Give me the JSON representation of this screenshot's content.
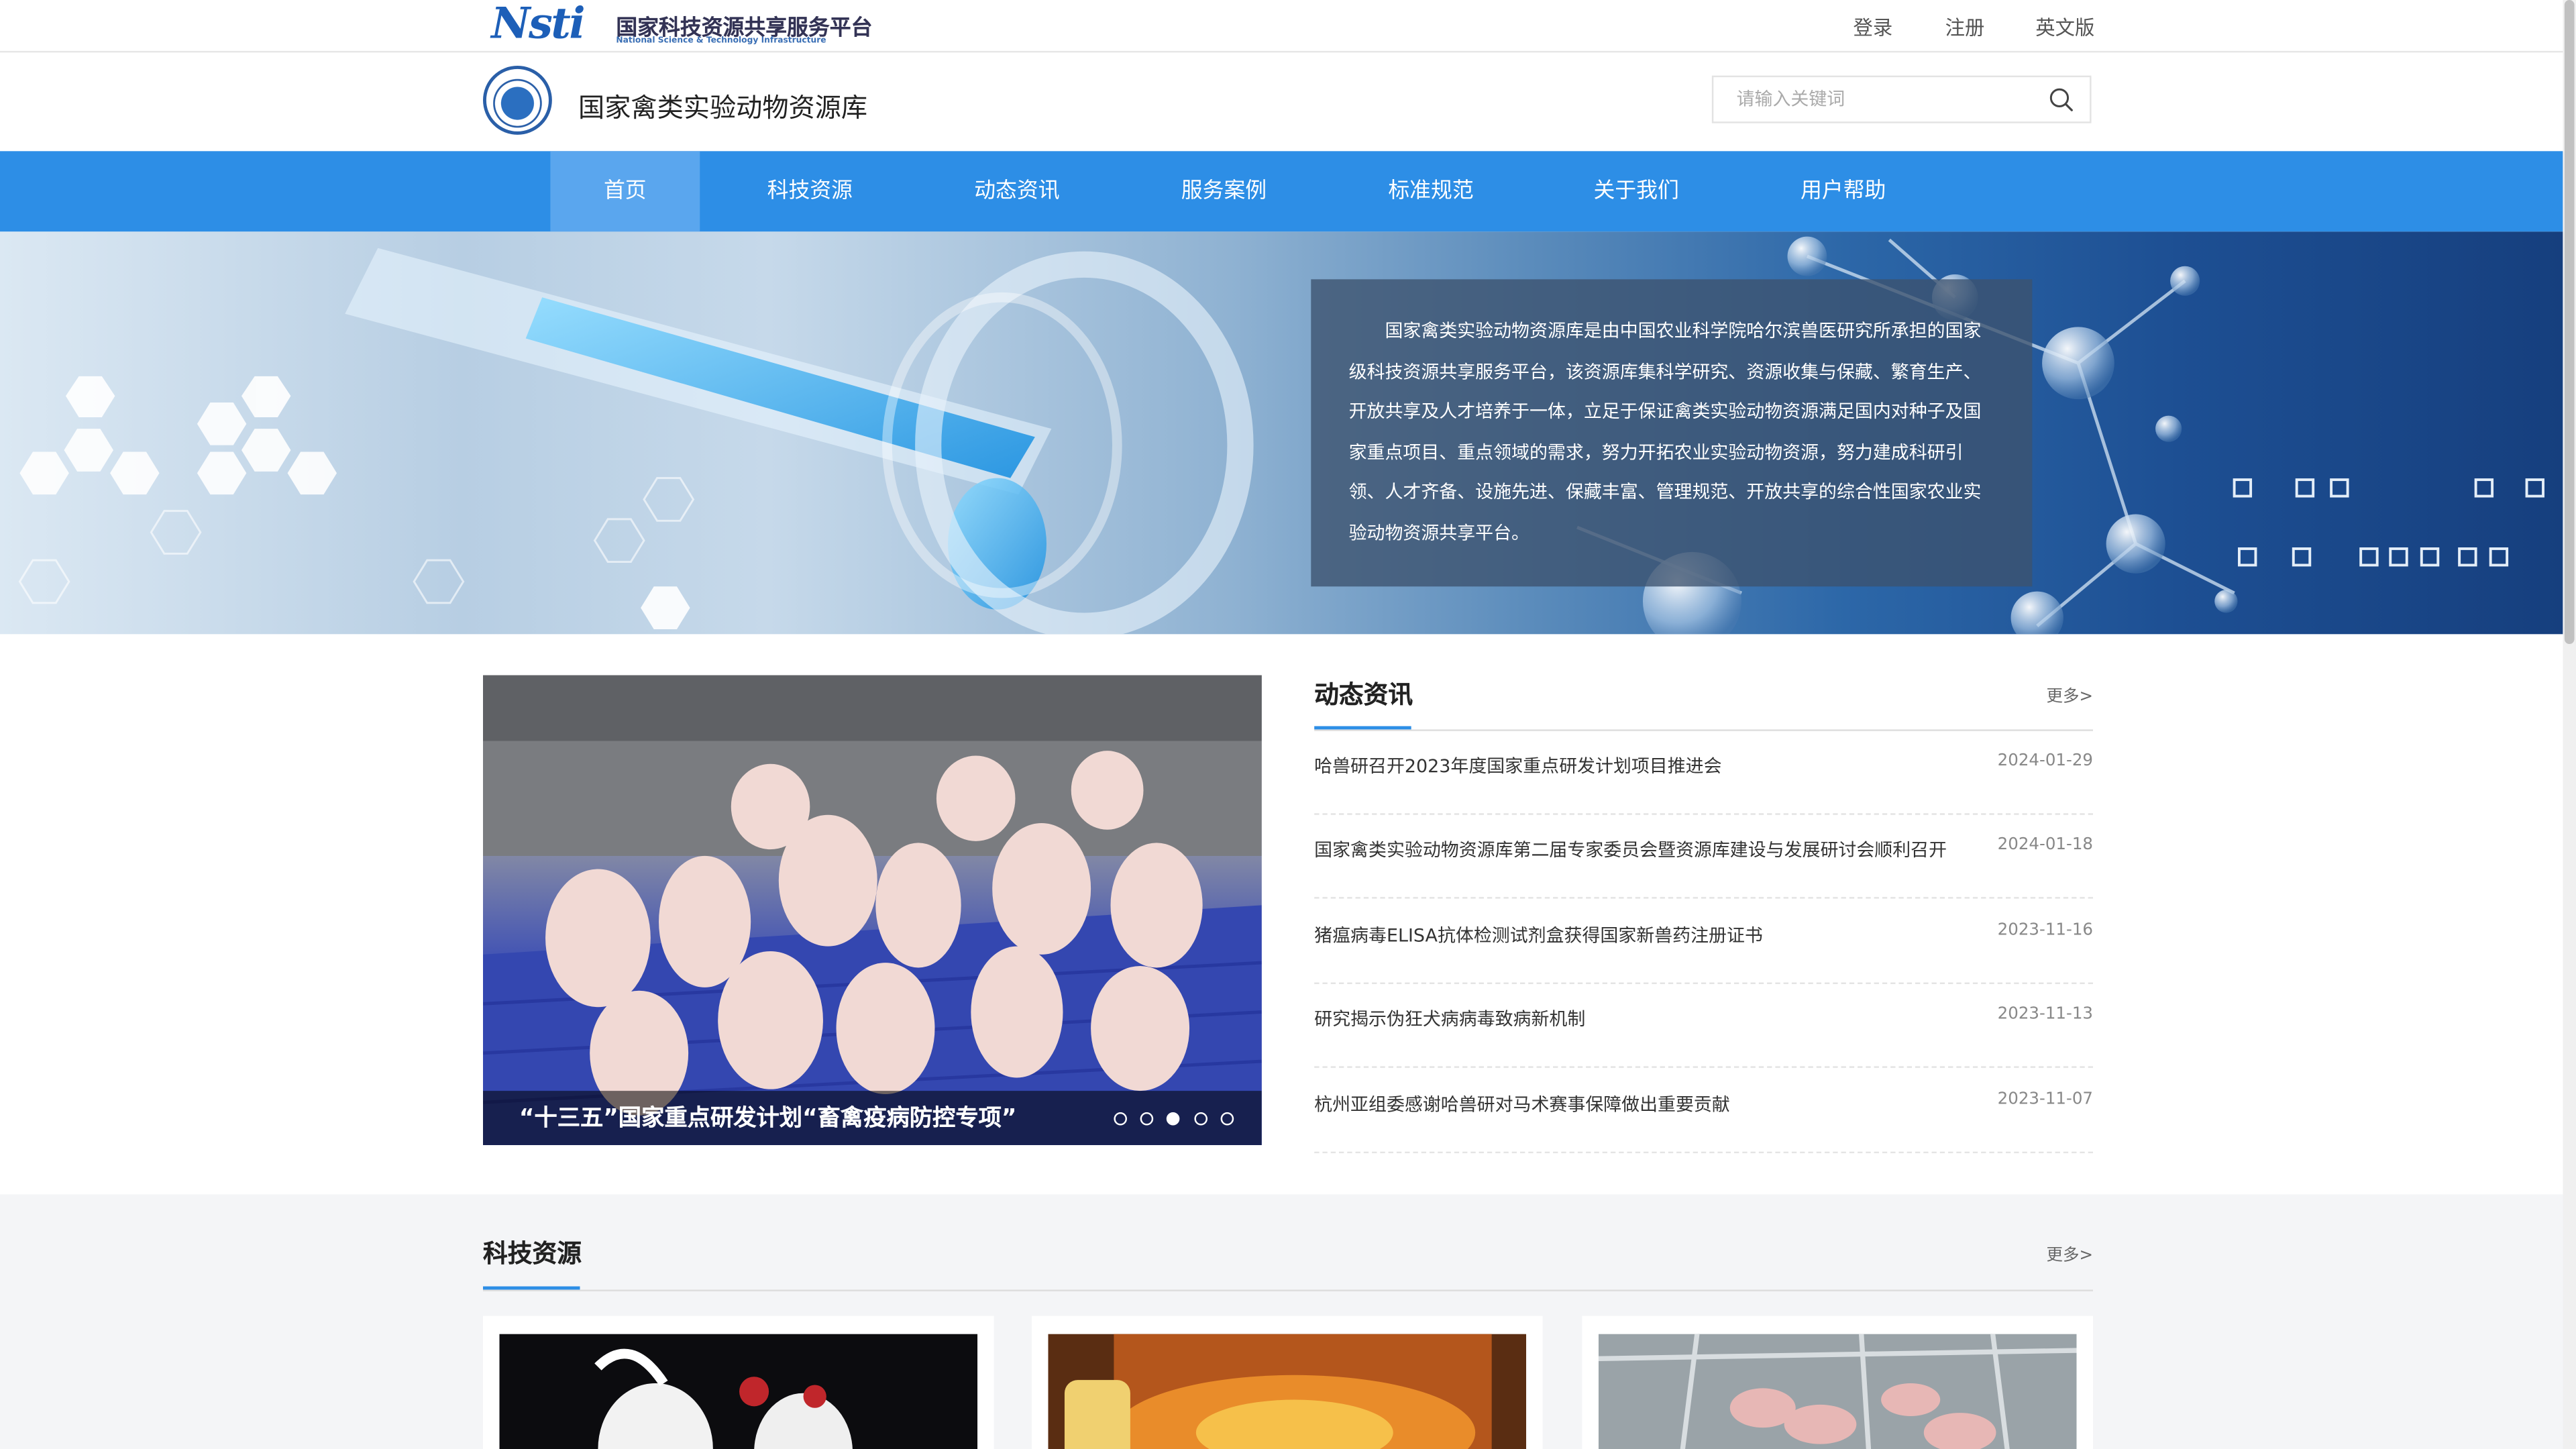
{
  "topbar": {
    "logo_mark": "Nsti",
    "logo_cn": "国家科技资源共享服务平台",
    "logo_en": "National Science & Technology Infrastructure",
    "login": "登录",
    "register": "注册",
    "english": "英文版"
  },
  "header": {
    "site_title": "国家禽类实验动物资源库",
    "search_placeholder": "请输入关键词"
  },
  "nav": {
    "items": [
      {
        "label": "首页",
        "active": true
      },
      {
        "label": "科技资源"
      },
      {
        "label": "动态资讯"
      },
      {
        "label": "服务案例"
      },
      {
        "label": "标准规范"
      },
      {
        "label": "关于我们"
      },
      {
        "label": "用户帮助"
      }
    ]
  },
  "banner": {
    "intro": "国家禽类实验动物资源库是由中国农业科学院哈尔滨兽医研究所承担的国家级科技资源共享服务平台，该资源库集科学研究、资源收集与保藏、繁育生产、开放共享及人才培养于一体，立足于保证禽类实验动物资源满足国内对种子及国家重点项目、重点领域的需求，努力开拓农业实验动物资源，努力建成科研引领、人才齐备、设施先进、保藏丰富、管理规范、开放共享的综合性国家农业实验动物资源共享平台。"
  },
  "slider": {
    "caption": "“十三五”国家重点研发计划“畜禽疫病防控专项”",
    "dots": 5,
    "active_dot": 3
  },
  "news": {
    "title": "动态资讯",
    "more": "更多>",
    "items": [
      {
        "text": "哈兽研召开2023年度国家重点研发计划项目推进会",
        "date": "2024-01-29"
      },
      {
        "text": "国家禽类实验动物资源库第二届专家委员会暨资源库建设与发展研讨会顺利召开",
        "date": "2024-01-18"
      },
      {
        "text": "猪瘟病毒ELISA抗体检测试剂盒获得国家新兽药注册证书",
        "date": "2023-11-16"
      },
      {
        "text": "研究揭示伪狂犬病病毒致病新机制",
        "date": "2023-11-13"
      },
      {
        "text": "杭州亚组委感谢哈兽研对马术赛事保障做出重要贡献",
        "date": "2023-11-07"
      }
    ]
  },
  "resources": {
    "title": "科技资源",
    "more": "更多>"
  },
  "colors": {
    "nav_blue": "#2d8ee6",
    "nav_active": "#5aa6ee",
    "accent": "#2d8ee6"
  }
}
